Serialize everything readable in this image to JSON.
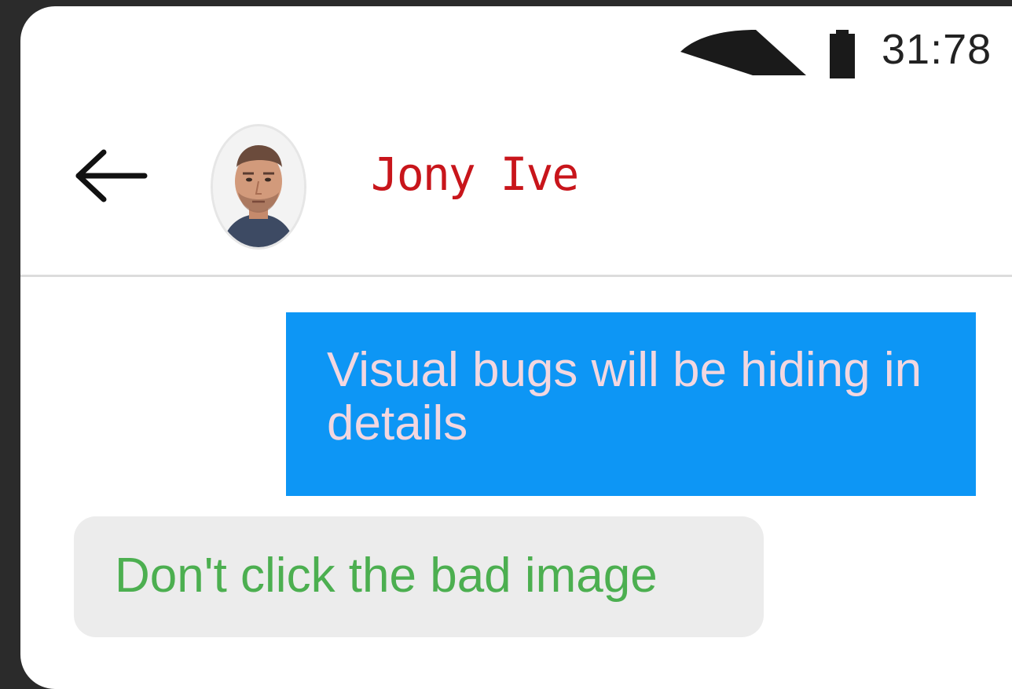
{
  "status_bar": {
    "time": "31:78",
    "icons": [
      "wifi-icon",
      "signal-icon",
      "battery-icon"
    ]
  },
  "header": {
    "back_icon": "arrow-left-icon",
    "contact_name": "Jony Ive",
    "contact_name_color": "#c8151b"
  },
  "messages": [
    {
      "direction": "sent",
      "text": "Visual bugs will be hiding in details",
      "bubble_color": "#0d96f5",
      "text_color": "#f2d7e0"
    },
    {
      "direction": "received",
      "text": "Don't click the bad image",
      "bubble_color": "#ececec",
      "text_color": "#4caf50"
    }
  ]
}
